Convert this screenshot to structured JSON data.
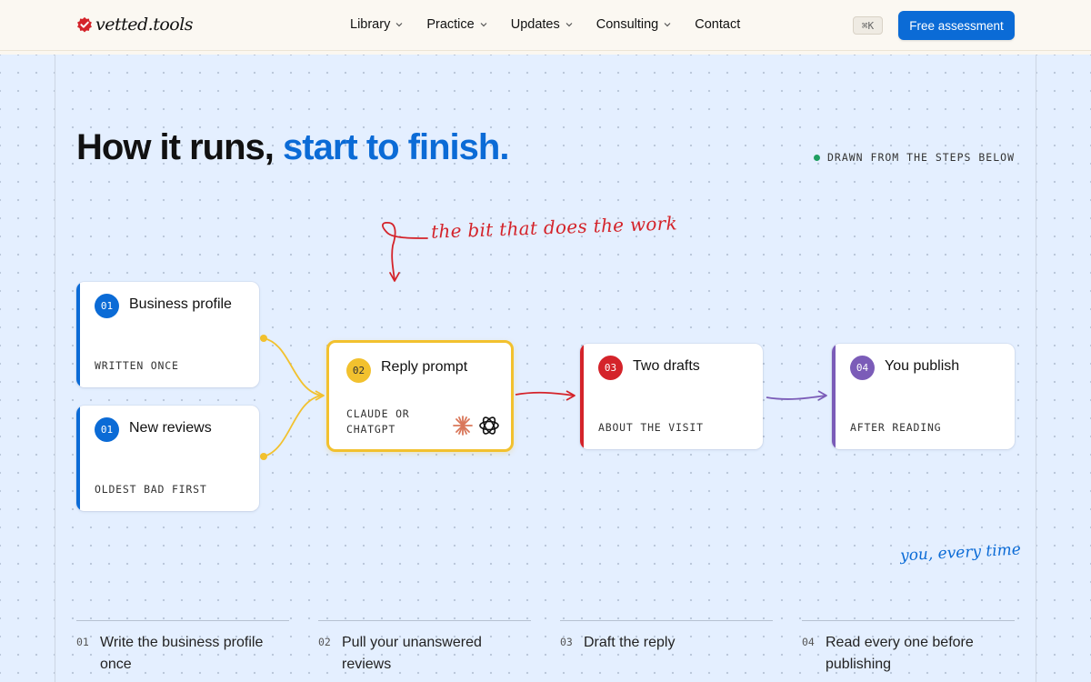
{
  "header": {
    "brand": "vetted.tools",
    "nav": [
      {
        "label": "Library",
        "dropdown": true
      },
      {
        "label": "Practice",
        "dropdown": true
      },
      {
        "label": "Updates",
        "dropdown": true
      },
      {
        "label": "Consulting",
        "dropdown": true
      },
      {
        "label": "Contact",
        "dropdown": false
      }
    ],
    "shortcut": "⌘K",
    "cta": "Free assessment"
  },
  "hero": {
    "title_plain": "How it runs, ",
    "title_accent": "start to finish.",
    "status": "DRAWN FROM THE STEPS BELOW",
    "annotation_top": "the bit that does the work",
    "annotation_bottom": "you, every time"
  },
  "flow": {
    "nodes": [
      {
        "num": "01",
        "title": "Business profile",
        "sub": "WRITTEN ONCE"
      },
      {
        "num": "01",
        "title": "New reviews",
        "sub": "OLDEST BAD FIRST"
      },
      {
        "num": "02",
        "title": "Reply prompt",
        "sub_line1": "CLAUDE OR",
        "sub_line2": "CHATGPT"
      },
      {
        "num": "03",
        "title": "Two drafts",
        "sub": "ABOUT THE VISIT"
      },
      {
        "num": "04",
        "title": "You publish",
        "sub": "AFTER READING"
      }
    ]
  },
  "steps": [
    {
      "num": "01",
      "text": "Write the business profile once"
    },
    {
      "num": "02",
      "text": "Pull your unanswered reviews"
    },
    {
      "num": "03",
      "text": "Draft the reply"
    },
    {
      "num": "04",
      "text": "Read every one before publishing"
    }
  ],
  "colors": {
    "accent": "#0b6bd6",
    "brand_red": "#d4232a",
    "highlight": "#f2c12e",
    "purple": "#7b5cb8",
    "status_green": "#1e9e61"
  }
}
